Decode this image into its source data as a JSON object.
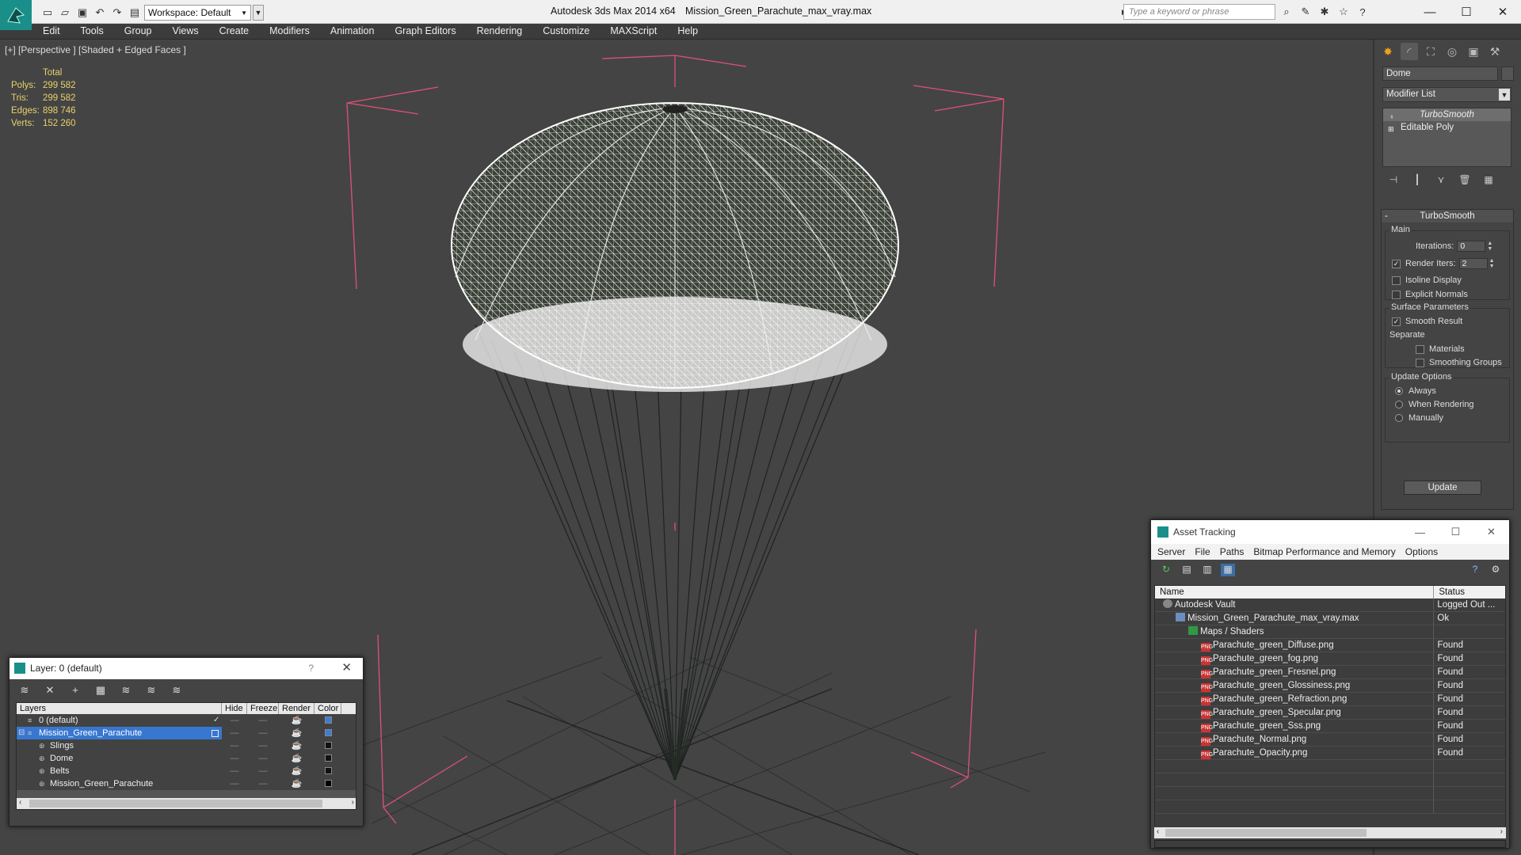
{
  "titlebar": {
    "app_title": "Autodesk 3ds Max  2014 x64",
    "file_title": "Mission_Green_Parachute_max_vray.max",
    "workspace": "Workspace: Default",
    "search_placeholder": "Type a keyword or phrase",
    "minimize": "—",
    "maximize": "☐",
    "close": "✕"
  },
  "menu": [
    "Edit",
    "Tools",
    "Group",
    "Views",
    "Create",
    "Modifiers",
    "Animation",
    "Graph Editors",
    "Rendering",
    "Customize",
    "MAXScript",
    "Help"
  ],
  "viewport": {
    "label": "[+] [Perspective ] [Shaded + Edged Faces ]",
    "stats": {
      "header": "Total",
      "polys_label": "Polys:",
      "polys": "299 582",
      "tris_label": "Tris:",
      "tris": "299 582",
      "edges_label": "Edges:",
      "edges": "898 746",
      "verts_label": "Verts:",
      "verts": "152 260"
    }
  },
  "command_panel": {
    "object_name": "Dome",
    "modifier_list": "Modifier List",
    "stack": [
      "TurboSmooth",
      "Editable Poly"
    ],
    "turbosmooth": {
      "title": "TurboSmooth",
      "main": "Main",
      "iterations_label": "Iterations:",
      "iterations": "0",
      "render_iters_label": "Render Iters:",
      "render_iters": "2",
      "isoline": "Isoline Display",
      "explicit_normals": "Explicit Normals",
      "surface_params": "Surface Parameters",
      "smooth_result": "Smooth Result",
      "separate": "Separate",
      "materials": "Materials",
      "smoothing_groups": "Smoothing Groups",
      "update_options": "Update Options",
      "always": "Always",
      "when_rendering": "When Rendering",
      "manually": "Manually",
      "update": "Update"
    }
  },
  "layer_dialog": {
    "title": "Layer: 0 (default)",
    "help": "?",
    "close": "✕",
    "headers": [
      "Layers",
      "Hide",
      "Freeze",
      "Render",
      "Color"
    ],
    "rows": [
      {
        "name": "0 (default)",
        "color": "#3b7dd8",
        "indent": 1
      },
      {
        "name": "Mission_Green_Parachute",
        "color": "#3b7dd8",
        "indent": 1
      },
      {
        "name": "Slings",
        "color": "#111111",
        "indent": 2
      },
      {
        "name": "Dome",
        "color": "#111111",
        "indent": 2
      },
      {
        "name": "Belts",
        "color": "#111111",
        "indent": 2
      },
      {
        "name": "Mission_Green_Parachute",
        "color": "#000000",
        "indent": 2
      }
    ]
  },
  "asset_tracking": {
    "title": "Asset Tracking",
    "menu": [
      "Server",
      "File",
      "Paths",
      "Bitmap Performance and Memory",
      "Options"
    ],
    "headers": [
      "Name",
      "Status"
    ],
    "rows": [
      {
        "name": "Autodesk Vault",
        "status": "Logged Out ...",
        "icon": "vault",
        "indent": 1
      },
      {
        "name": "Mission_Green_Parachute_max_vray.max",
        "status": "Ok",
        "icon": "file",
        "indent": 2
      },
      {
        "name": "Maps / Shaders",
        "status": "",
        "icon": "folder",
        "indent": 3
      },
      {
        "name": "Parachute_green_Diffuse.png",
        "status": "Found",
        "icon": "png",
        "indent": 4
      },
      {
        "name": "Parachute_green_fog.png",
        "status": "Found",
        "icon": "png",
        "indent": 4
      },
      {
        "name": "Parachute_green_Fresnel.png",
        "status": "Found",
        "icon": "png",
        "indent": 4
      },
      {
        "name": "Parachute_green_Glossiness.png",
        "status": "Found",
        "icon": "png",
        "indent": 4
      },
      {
        "name": "Parachute_green_Refraction.png",
        "status": "Found",
        "icon": "png",
        "indent": 4
      },
      {
        "name": "Parachute_green_Specular.png",
        "status": "Found",
        "icon": "png",
        "indent": 4
      },
      {
        "name": "Parachute_green_Sss.png",
        "status": "Found",
        "icon": "png",
        "indent": 4
      },
      {
        "name": "Parachute_Normal.png",
        "status": "Found",
        "icon": "png",
        "indent": 4
      },
      {
        "name": "Parachute_Opacity.png",
        "status": "Found",
        "icon": "png",
        "indent": 4
      }
    ]
  }
}
